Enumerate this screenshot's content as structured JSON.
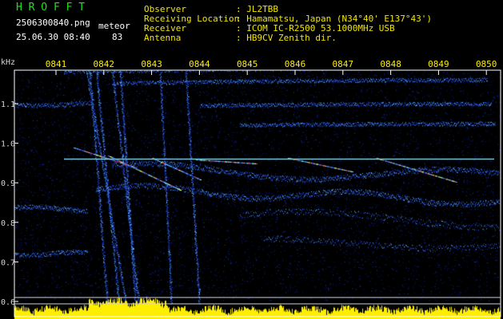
{
  "header": {
    "app_title": "H R O F F T",
    "filename": "2506300840.png",
    "datetime": "25.06.30 08:40",
    "mode_label": "meteor",
    "count": "83",
    "info": [
      {
        "label": "Observer",
        "value": ": JL2TBB"
      },
      {
        "label": "Receiving Location",
        "value": ": Hamamatsu, Japan (N34°40' E137°43')"
      },
      {
        "label": "Receiver",
        "value": ": ICOM IC-R2500 53.1000MHz USB"
      },
      {
        "label": "Antenna",
        "value": ": HB9CV Zenith dir."
      }
    ]
  },
  "chart_data": {
    "type": "heatmap",
    "title": "",
    "ylabel": "kHz",
    "x_ticks": [
      "0841",
      "0842",
      "0843",
      "0844",
      "0845",
      "0846",
      "0847",
      "0848",
      "0849",
      "0850"
    ],
    "y_ticks": [
      "1.1",
      "1.0",
      "0.9",
      "0.8",
      "0.7",
      "0.6"
    ],
    "ylim": [
      0.58,
      1.17
    ],
    "reference_line_khz": 0.96,
    "baseline_khz": 0.61,
    "colors": {
      "background": "#000000",
      "axis": "#ffffff",
      "reference_line": "#30d8ff",
      "noise": "#1030c0",
      "signal": "#40a0ff",
      "hot": "#ff3030",
      "level_bar": "#ffee00"
    }
  }
}
